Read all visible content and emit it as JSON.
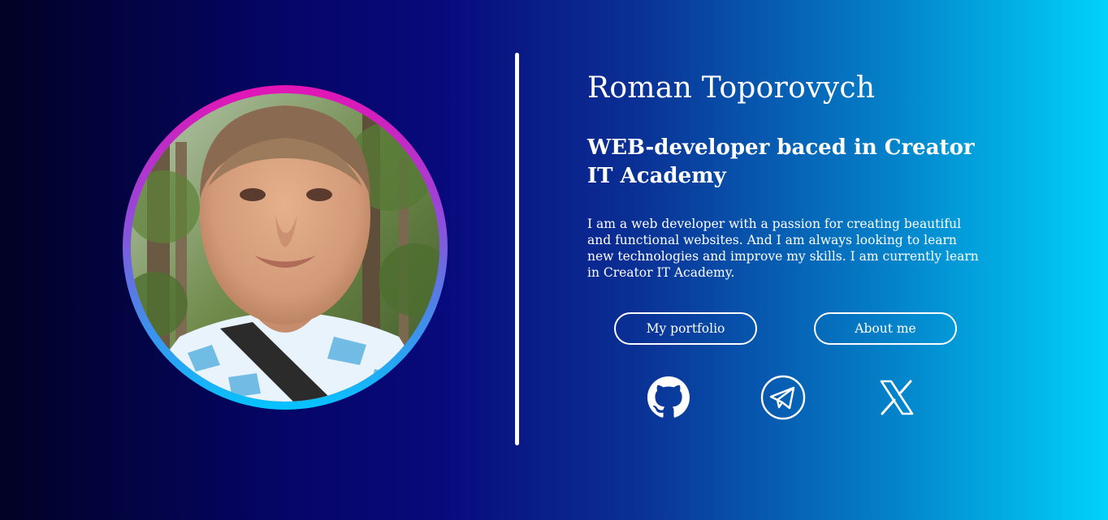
{
  "profile": {
    "name": "Roman Toporovych",
    "role": "WEB-developer baced in Creator IT Academy",
    "bio": "I am a web developer with a passion for creating beautiful and functional websites. And I am always looking to learn new technologies and improve my skills. I am currently learn in Creator IT Academy.",
    "photo_icon": "profile-photo"
  },
  "buttons": {
    "portfolio": "My portfolio",
    "about": "About me"
  },
  "social": [
    {
      "icon": "github-icon"
    },
    {
      "icon": "telegram-icon"
    },
    {
      "icon": "x-icon"
    }
  ],
  "colors": {
    "background_start": "#010224",
    "background_mid": "#080a7c",
    "background_end": "#00d2fb",
    "ring_top": "#e414b4",
    "ring_bottom": "#05c4ff",
    "text": "#ffffff"
  }
}
